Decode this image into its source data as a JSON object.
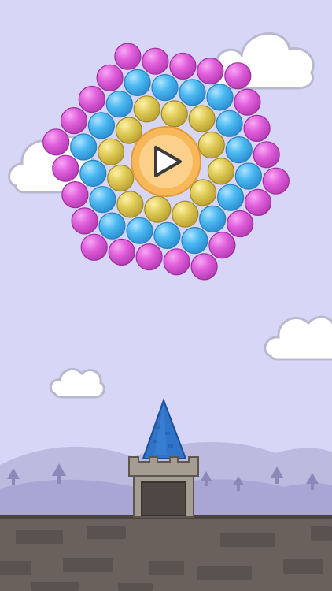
{
  "game": {
    "background_color": "#d7d6f7",
    "play_button": {
      "icon": "play-icon",
      "ring_color": "#f8b85a",
      "core_color": "#fbd08a"
    },
    "bubble_colors": {
      "magenta": "#d650d6",
      "blue": "#45b4ee",
      "gold": "#d7c24d"
    },
    "bubble_cluster": {
      "rings": [
        {
          "ring": "outer",
          "color": "magenta",
          "count": 24
        },
        {
          "ring": "middle",
          "color": "blue",
          "count": 18
        },
        {
          "ring": "inner",
          "color": "gold",
          "count": 12
        }
      ]
    },
    "tower": {
      "roof_color": "#2f74c9",
      "stone_color": "#a59c92"
    },
    "hills_color": "#a9a6d4",
    "ground_color": "#6b615c",
    "clouds": 4,
    "trees": 7
  }
}
